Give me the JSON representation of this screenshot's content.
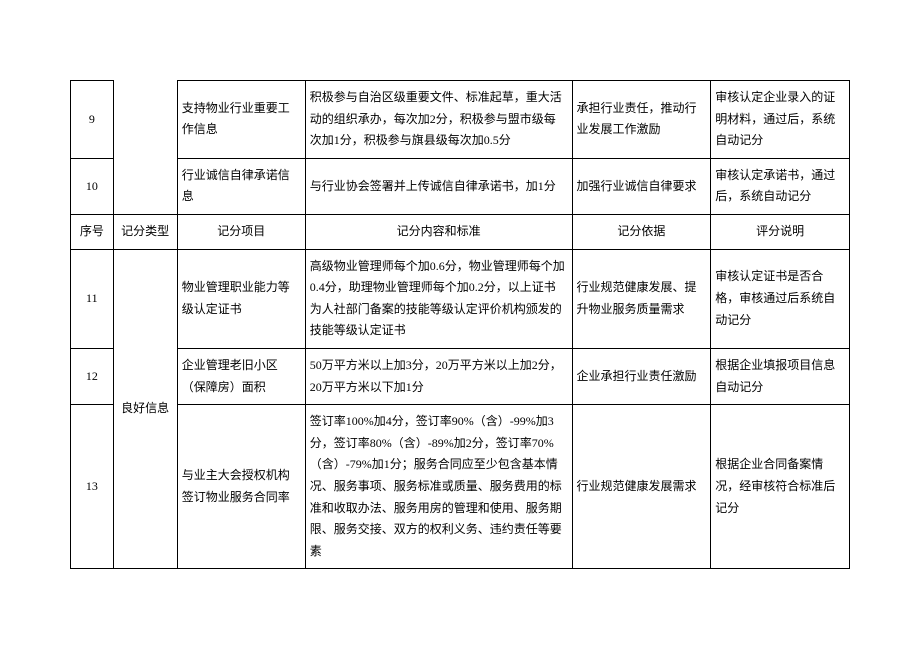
{
  "headers": {
    "seq": "序号",
    "type": "记分类型",
    "item": "记分项目",
    "content": "记分内容和标准",
    "basis": "记分依据",
    "desc": "评分说明"
  },
  "type_label": "良好信息",
  "rows": [
    {
      "seq": "9",
      "item": "支持物业行业重要工作信息",
      "content": "积极参与自治区级重要文件、标准起草，重大活动的组织承办，每次加2分，积极参与盟市级每次加1分，积极参与旗县级每次加0.5分",
      "basis": "承担行业责任，推动行业发展工作激励",
      "desc": "审核认定企业录入的证明材料，通过后，系统自动记分"
    },
    {
      "seq": "10",
      "item": "行业诚信自律承诺信息",
      "content": "与行业协会签署并上传诚信自律承诺书，加1分",
      "basis": "加强行业诚信自律要求",
      "desc": "审核认定承诺书，通过后，系统自动记分"
    },
    {
      "seq": "11",
      "item": "物业管理职业能力等级认定证书",
      "content": "高级物业管理师每个加0.6分，物业管理师每个加0.4分，助理物业管理师每个加0.2分，以上证书为人社部门备案的技能等级认定评价机构颁发的技能等级认定证书",
      "basis": "行业规范健康发展、提升物业服务质量需求",
      "desc": "审核认定证书是否合格，审核通过后系统自动记分"
    },
    {
      "seq": "12",
      "item": "企业管理老旧小区（保障房）面积",
      "content": "50万平方米以上加3分，20万平方米以上加2分，20万平方米以下加1分",
      "basis": "企业承担行业责任激励",
      "desc": "根据企业填报项目信息自动记分"
    },
    {
      "seq": "13",
      "item": "与业主大会授权机构签订物业服务合同率",
      "content": "签订率100%加4分，签订率90%（含）-99%加3分，签订率80%（含）-89%加2分，签订率70%（含）-79%加1分；服务合同应至少包含基本情况、服务事项、服务标准或质量、服务费用的标准和收取办法、服务用房的管理和使用、服务期限、服务交接、双方的权利义务、违约责任等要素",
      "basis": "行业规范健康发展需求",
      "desc": "根据企业合同备案情况，经审核符合标准后记分"
    }
  ]
}
